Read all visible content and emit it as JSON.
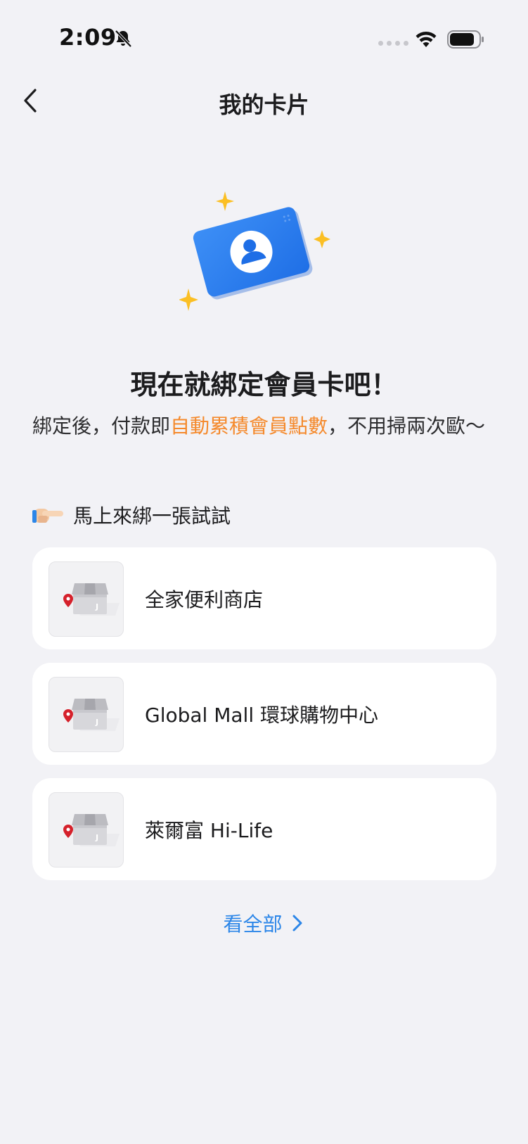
{
  "status_bar": {
    "time": "2:09",
    "icons": [
      "bell-slash-icon",
      "signal-dots-icon",
      "wifi-icon",
      "battery-icon"
    ]
  },
  "nav": {
    "title": "我的卡片",
    "back_icon": "chevron-left-icon"
  },
  "hero": {
    "illustration": "member-card-icon",
    "headline": "現在就綁定會員卡吧！",
    "subtext_before": "綁定後，付款即",
    "subtext_highlight": "自動累積會員點數",
    "subtext_after": "，不用掃兩次歐～"
  },
  "section": {
    "icon": "pointing-hand-icon",
    "label": "馬上來綁一張試試"
  },
  "stores": [
    {
      "name": "全家便利商店",
      "icon": "store-placeholder-icon"
    },
    {
      "name": "Global Mall 環球購物中心",
      "icon": "store-placeholder-icon"
    },
    {
      "name": "萊爾富 Hi-Life",
      "icon": "store-placeholder-icon"
    }
  ],
  "view_all": {
    "label": "看全部",
    "icon": "chevron-right-icon"
  },
  "colors": {
    "background": "#f2f2f6",
    "accent_blue": "#2c86e8",
    "highlight_orange": "#f5892b",
    "card_blue": "#2f7df0",
    "sparkle_yellow": "#fbbf24",
    "pin_red": "#d5212b"
  }
}
